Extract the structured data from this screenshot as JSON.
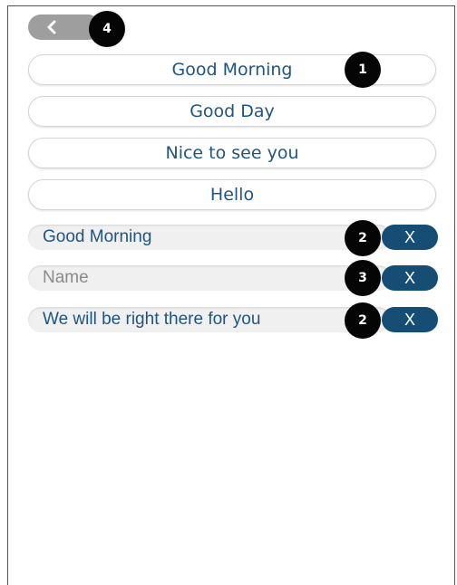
{
  "back_button": {
    "icon": "chevron-left-icon"
  },
  "badges": {
    "b1": "1",
    "b2a": "2",
    "b3": "3",
    "b2b": "2",
    "b4": "4"
  },
  "greetings": [
    {
      "label": "Good Morning"
    },
    {
      "label": "Good Day"
    },
    {
      "label": "Nice to see you"
    },
    {
      "label": "Hello"
    }
  ],
  "fields": [
    {
      "value": "Good Morning",
      "placeholder": "",
      "clear_label": "X"
    },
    {
      "value": "",
      "placeholder": "Name",
      "clear_label": "X"
    },
    {
      "value": "We will be right there for you",
      "placeholder": "",
      "clear_label": "X"
    }
  ],
  "colors": {
    "accent": "#154d75",
    "text": "#1f5580",
    "back_button": "#9e9e9e",
    "badge": "#050505"
  }
}
